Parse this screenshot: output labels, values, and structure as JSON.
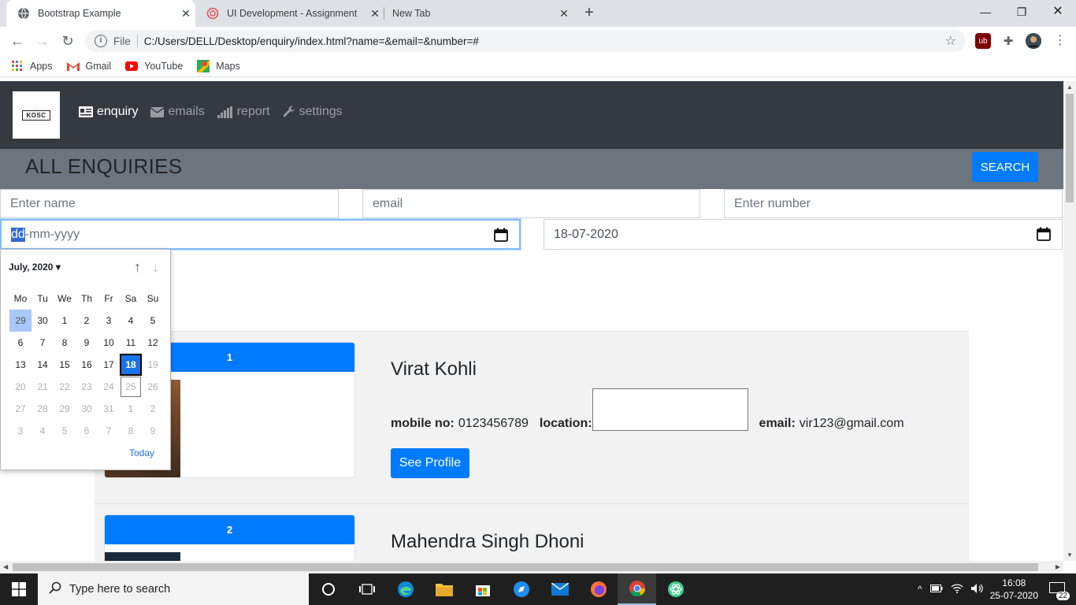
{
  "browser": {
    "tabs": [
      {
        "title": "Bootstrap Example",
        "active": true
      },
      {
        "title": "UI Development - Assignment",
        "active": false
      },
      {
        "title": "New Tab",
        "active": false
      }
    ],
    "address": {
      "scheme_label": "File",
      "url": "C:/Users/DELL/Desktop/enquiry/index.html?name=&email=&number=#"
    },
    "bookmarks": [
      {
        "label": "Apps",
        "icon": "apps-grid-icon"
      },
      {
        "label": "Gmail",
        "icon": "gmail-icon"
      },
      {
        "label": "YouTube",
        "icon": "youtube-icon"
      },
      {
        "label": "Maps",
        "icon": "maps-icon"
      }
    ],
    "extension_badge": "ub"
  },
  "navbar": {
    "logo_text": "KOSC",
    "links": [
      {
        "label": "enquiry",
        "icon": "id-card-icon",
        "active": true
      },
      {
        "label": "emails",
        "icon": "envelope-icon",
        "active": false
      },
      {
        "label": "report",
        "icon": "signal-bars-icon",
        "active": false
      },
      {
        "label": "settings",
        "icon": "wrench-icon",
        "active": false
      }
    ]
  },
  "header": {
    "title": "ALL ENQUIRIES",
    "search_label": "SEARCH"
  },
  "filters": {
    "name_placeholder": "Enter name",
    "email_placeholder": "email",
    "number_placeholder": "Enter number",
    "date_from_day": "dd",
    "date_from_rest": "-mm-yyyy",
    "date_to_value": "18-07-2020"
  },
  "datepicker": {
    "month_label": "July, 2020",
    "weekdays": [
      "Mo",
      "Tu",
      "We",
      "Th",
      "Fr",
      "Sa",
      "Su"
    ],
    "weeks": [
      [
        "29",
        "30",
        "1",
        "2",
        "3",
        "4",
        "5"
      ],
      [
        "6",
        "7",
        "8",
        "9",
        "10",
        "11",
        "12"
      ],
      [
        "13",
        "14",
        "15",
        "16",
        "17",
        "18",
        "19"
      ],
      [
        "20",
        "21",
        "22",
        "23",
        "24",
        "25",
        "26"
      ],
      [
        "27",
        "28",
        "29",
        "30",
        "31",
        "1",
        "2"
      ],
      [
        "3",
        "4",
        "5",
        "6",
        "7",
        "8",
        "9"
      ]
    ],
    "today_label": "Today",
    "selected_day": "18"
  },
  "enquiries": [
    {
      "index": "1",
      "name": "Virat Kohli",
      "mobile_label": "mobile no:",
      "mobile": "0123456789",
      "location_label": "location:",
      "email_label": "email:",
      "email": "vir123@gmail.com",
      "profile_button": "See Profile"
    },
    {
      "index": "2",
      "name": "Mahendra Singh Dhoni"
    }
  ],
  "taskbar": {
    "search_placeholder": "Type here to search",
    "time": "16:08",
    "date": "25-07-2020",
    "notification_count": "22"
  }
}
